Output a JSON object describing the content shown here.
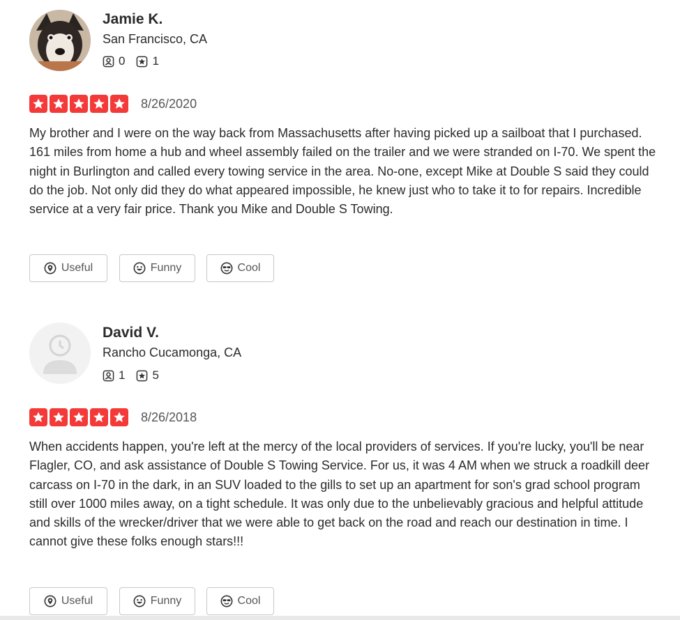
{
  "colors": {
    "star_red": "#f43939",
    "text": "#2b2b2b",
    "border": "#c8c8c8"
  },
  "reviews": [
    {
      "name": "Jamie K.",
      "location": "San Francisco, CA",
      "friends": "0",
      "reviews_count": "1",
      "rating": 5,
      "date": "8/26/2020",
      "text": "My brother and I were on the way back from Massachusetts after having picked up a sailboat that I purchased.  161 miles from home a hub and wheel assembly failed on the trailer and we were stranded on I-70.  We spent the night in Burlington and called every towing service in the area.  No-one, except Mike at Double S said they could do the job.  Not only did they do what appeared impossible, he knew just who to take it to for repairs.  Incredible service at a very fair price.  Thank you Mike and Double S Towing.",
      "votes": {
        "useful": "Useful",
        "funny": "Funny",
        "cool": "Cool"
      }
    },
    {
      "name": "David V.",
      "location": "Rancho Cucamonga, CA",
      "friends": "1",
      "reviews_count": "5",
      "rating": 5,
      "date": "8/26/2018",
      "text": "When accidents happen, you're left at the mercy of the local providers of services.  If you're lucky, you'll be near Flagler, CO, and ask assistance of Double S Towing Service.  For us, it was 4 AM when we struck a roadkill deer carcass on I-70 in the dark, in an SUV loaded to the gills to set up an apartment for son's grad school program still over 1000 miles away, on a tight schedule.  It was only due to the unbelievably gracious and helpful attitude and skills of the wrecker/driver that we were able to get back on the road and reach our destination in time.  I cannot give these folks enough stars!!!",
      "votes": {
        "useful": "Useful",
        "funny": "Funny",
        "cool": "Cool"
      }
    }
  ]
}
